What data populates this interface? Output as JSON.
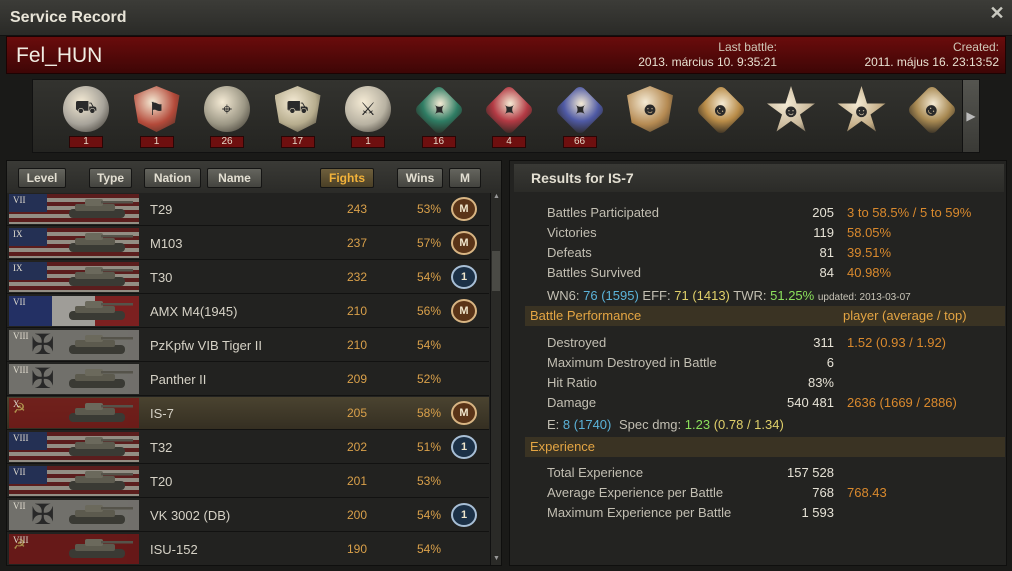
{
  "window": {
    "title": "Service Record",
    "close_icon": "close-icon"
  },
  "player": {
    "name": "Fel_HUN",
    "last_battle_label": "Last battle:",
    "last_battle_value": "2013. március 10. 9:35:21",
    "created_label": "Created:",
    "created_value": "2011. május 16. 23:13:52"
  },
  "medals": [
    {
      "icon": "tank-medal-icon",
      "count": "1",
      "color": "#a7a39a"
    },
    {
      "icon": "flag-medal-icon",
      "count": "1",
      "color": "#b44a3a"
    },
    {
      "icon": "crosshair-tank-medal-icon",
      "count": "26",
      "color": "#9c9785"
    },
    {
      "icon": "tank-shield-medal-icon",
      "count": "17",
      "color": "#b7ad8e"
    },
    {
      "icon": "sword-laurel-medal-icon",
      "count": "1",
      "color": "#b8b2a2"
    },
    {
      "icon": "green-ribbon-medal-icon",
      "count": "16",
      "color": "#2f7d64"
    },
    {
      "icon": "red-ribbon-medal-icon",
      "count": "4",
      "color": "#b33a44"
    },
    {
      "icon": "blue-ribbon-medal-icon",
      "count": "66",
      "color": "#4f5aa5"
    },
    {
      "icon": "portrait-medal-icon",
      "count": "",
      "color": "#b58a52"
    },
    {
      "icon": "cross-medal-icon",
      "count": "",
      "color": "#b98c48"
    },
    {
      "icon": "star-medal-icon",
      "count": "",
      "color": "#c9b89a"
    },
    {
      "icon": "star-medal-icon",
      "count": "",
      "color": "#c2ab84"
    },
    {
      "icon": "cross-medal-icon",
      "count": "",
      "color": "#a88952"
    }
  ],
  "sort_buttons": {
    "level": "Level",
    "type": "Type",
    "nation": "Nation",
    "name": "Name",
    "fights": "Fights",
    "wins": "Wins",
    "m": "M"
  },
  "vehicles": [
    {
      "tier": "VII",
      "nation": "usa",
      "name": "T29",
      "fights": "243",
      "wins": "53%",
      "mastery": "M"
    },
    {
      "tier": "IX",
      "nation": "usa",
      "name": "M103",
      "fights": "237",
      "wins": "57%",
      "mastery": "M"
    },
    {
      "tier": "IX",
      "nation": "usa",
      "name": "T30",
      "fights": "232",
      "wins": "54%",
      "mastery": "1"
    },
    {
      "tier": "VII",
      "nation": "fr",
      "name": "AMX M4(1945)",
      "fights": "210",
      "wins": "56%",
      "mastery": "M"
    },
    {
      "tier": "VIII",
      "nation": "de",
      "name": "PzKpfw VIB Tiger II",
      "fights": "210",
      "wins": "54%",
      "mastery": ""
    },
    {
      "tier": "VIII",
      "nation": "de",
      "name": "Panther II",
      "fights": "209",
      "wins": "52%",
      "mastery": ""
    },
    {
      "tier": "X",
      "nation": "ussr",
      "name": "IS-7",
      "fights": "205",
      "wins": "58%",
      "mastery": "M"
    },
    {
      "tier": "VIII",
      "nation": "usa",
      "name": "T32",
      "fights": "202",
      "wins": "51%",
      "mastery": "1"
    },
    {
      "tier": "VII",
      "nation": "usa",
      "name": "T20",
      "fights": "201",
      "wins": "53%",
      "mastery": ""
    },
    {
      "tier": "VII",
      "nation": "de",
      "name": "VK 3002 (DB)",
      "fights": "200",
      "wins": "54%",
      "mastery": "1"
    },
    {
      "tier": "VIII",
      "nation": "ussr",
      "name": "ISU-152",
      "fights": "190",
      "wins": "54%",
      "mastery": ""
    }
  ],
  "results": {
    "title": "Results for IS-7",
    "summary": [
      {
        "label": "Battles Participated",
        "value": "205",
        "extra": "3 to 58.5% / 5 to 59%"
      },
      {
        "label": "Victories",
        "value": "119",
        "extra": "58.05%"
      },
      {
        "label": "Defeats",
        "value": "81",
        "extra": "39.51%"
      },
      {
        "label": "Battles Survived",
        "value": "84",
        "extra": "40.98%"
      }
    ],
    "ratings": {
      "wn6_label": "WN6:",
      "wn6": "76",
      "wn6_alt": "(1595)",
      "eff_label": "EFF:",
      "eff": "71",
      "eff_alt": "(1413)",
      "twr_label": "TWR:",
      "twr": "51.25%",
      "updated": "updated: 2013-03-07"
    },
    "battle_perf": {
      "title": "Battle Performance",
      "right": "player (average / top)",
      "rows": [
        {
          "label": "Destroyed",
          "value": "311",
          "extra": "1.52 (0.93 / 1.92)"
        },
        {
          "label": "Maximum Destroyed in Battle",
          "value": "6",
          "extra": ""
        },
        {
          "label": "Hit Ratio",
          "value": "83%",
          "extra": ""
        },
        {
          "label": "Damage",
          "value": "540 481",
          "extra": "2636 (1669 / 2886)"
        }
      ],
      "e_label": "E:",
      "e": "8",
      "e_alt": "(1740)",
      "spec_label": "Spec dmg:",
      "spec": "1.23",
      "spec_alt": "(0.78 / 1.34)"
    },
    "experience": {
      "title": "Experience",
      "rows": [
        {
          "label": "Total Experience",
          "value": "157 528",
          "extra": ""
        },
        {
          "label": "Average Experience per Battle",
          "value": "768",
          "extra": "768.43"
        },
        {
          "label": "Maximum Experience per Battle",
          "value": "1 593",
          "extra": ""
        }
      ]
    }
  }
}
